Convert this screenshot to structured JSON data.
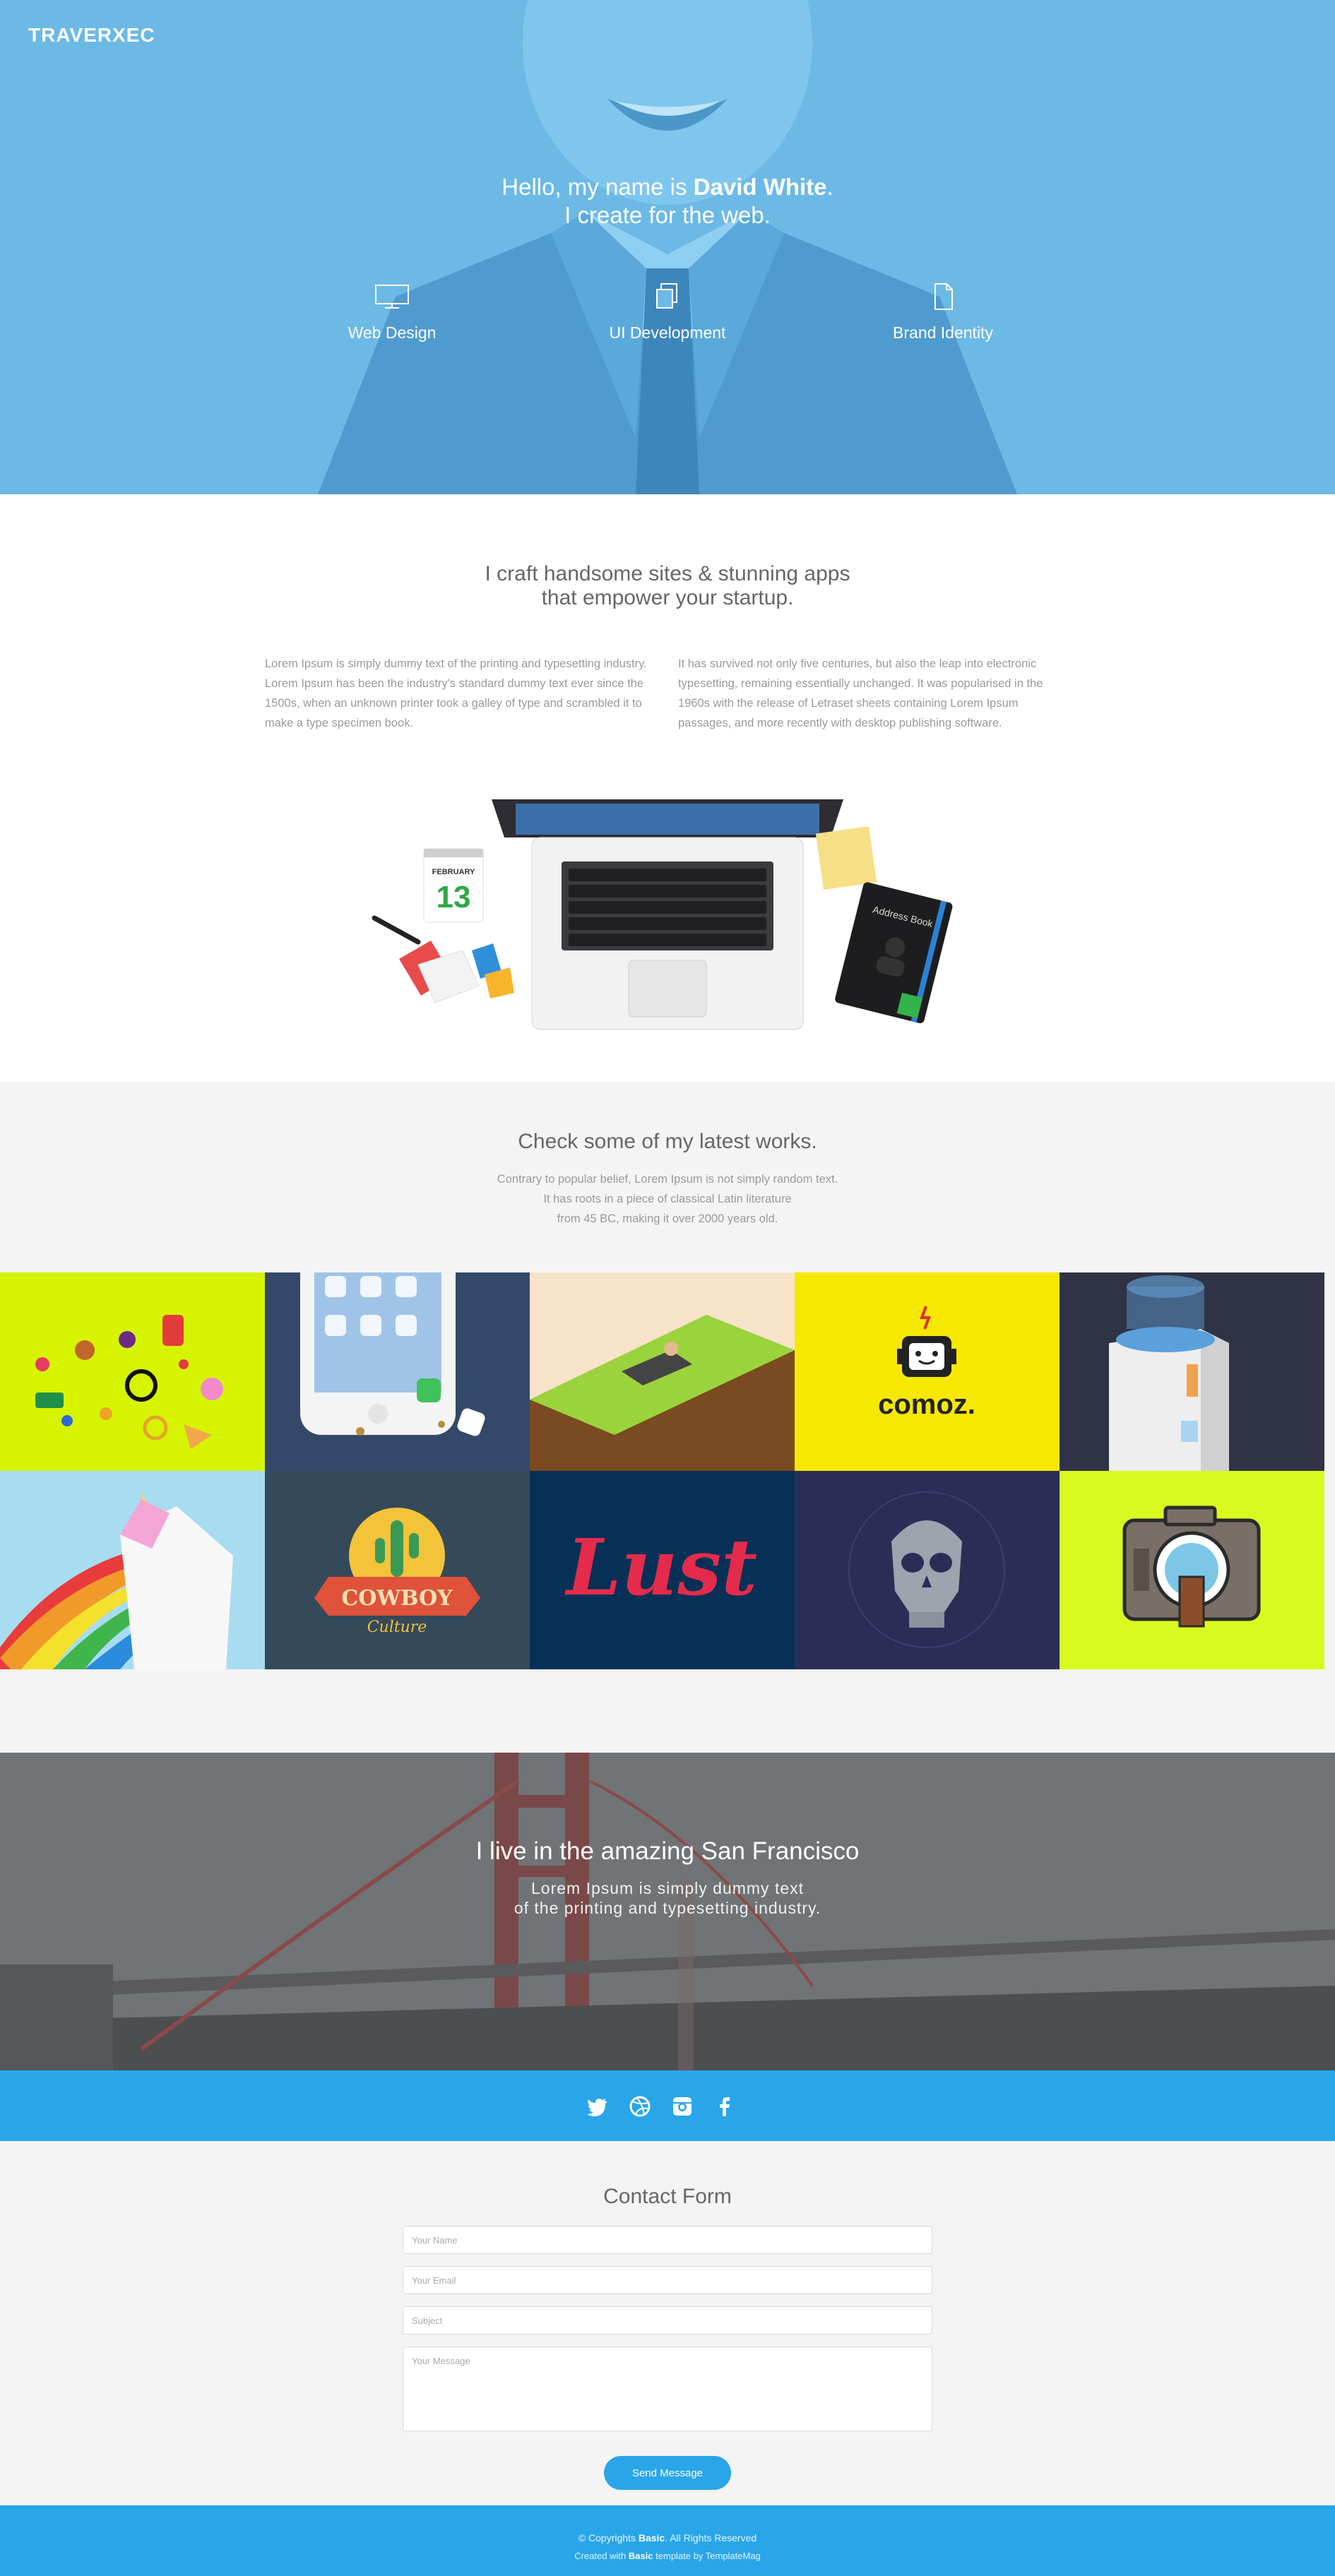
{
  "brand": "TRAVERXEC",
  "hero": {
    "greeting": "Hello, my name is",
    "name": "David White",
    "period": ".",
    "tagline": "I create for the web."
  },
  "services": [
    {
      "label": "Web Design",
      "icon": "monitor-icon"
    },
    {
      "label": "UI Development",
      "icon": "layers-icon"
    },
    {
      "label": "Brand Identity",
      "icon": "document-icon"
    }
  ],
  "about": {
    "title_line1": "I craft handsome sites & stunning apps",
    "title_line2": "that empower your startup.",
    "col1": "Lorem Ipsum is simply dummy text of the printing and typesetting industry. Lorem Ipsum has been the industry's standard dummy text ever since the 1500s, when an unknown printer took a galley of type and scrambled it to make a type specimen book.",
    "col2": "It has survived not only five centuries, but also the leap into electronic typesetting, remaining essentially unchanged. It was popularised in the 1960s with the release of Letraset sheets containing Lorem Ipsum passages, and more recently with desktop publishing software.",
    "calendar_month": "FEBRUARY",
    "calendar_day": "13",
    "notebook_label": "Address Book"
  },
  "works": {
    "title": "Check some of my latest works.",
    "sub_line1": "Contrary to popular belief, Lorem Ipsum is not simply random text.",
    "sub_line2": "It has roots in a piece of classical Latin literature",
    "sub_line3": "from 45 BC, making it over 2000 years old.",
    "tiles": [
      {
        "name": "sweets-illustration",
        "bg": "#d6f400"
      },
      {
        "name": "phone-illustration",
        "bg": "#34496a"
      },
      {
        "name": "lawn-illustration",
        "bg": "#f6e3c9"
      },
      {
        "name": "comoz-logo",
        "bg": "#f7e800",
        "text": "comoz."
      },
      {
        "name": "water-cooler-illustration",
        "bg": "#2f3345"
      },
      {
        "name": "unicorn-illustration",
        "bg": "#a8dcf0"
      },
      {
        "name": "cowboy-culture-logo",
        "bg": "#34495a",
        "text": "COWBOY",
        "text2": "Culture"
      },
      {
        "name": "lust-lettering",
        "bg": "#073056",
        "text": "Lust"
      },
      {
        "name": "skull-illustration",
        "bg": "#2b2d57"
      },
      {
        "name": "camera-illustration",
        "bg": "#d9fa1f"
      }
    ]
  },
  "city": {
    "title": "I live in the amazing San Francisco",
    "sub_line1": "Lorem Ipsum is simply dummy text",
    "sub_line2": "of the printing and typesetting industry."
  },
  "social": [
    "twitter-icon",
    "dribbble-icon",
    "instagram-icon",
    "facebook-icon"
  ],
  "contact": {
    "title": "Contact Form",
    "name_placeholder": "Your Name",
    "email_placeholder": "Your Email",
    "subject_placeholder": "Subject",
    "message_placeholder": "Your Message",
    "send_label": "Send Message"
  },
  "footer": {
    "copy_prefix": "© Copyrights",
    "copy_brand": "Basic",
    "copy_suffix": ". All Rights Reserved",
    "credit_prefix": "Created with",
    "credit_brand": "Basic",
    "credit_suffix": "template by TemplateMag"
  },
  "colors": {
    "accent": "#28a6e9",
    "hero_overlay": "#6cb9e6",
    "section_gray": "#f4f4f4"
  }
}
